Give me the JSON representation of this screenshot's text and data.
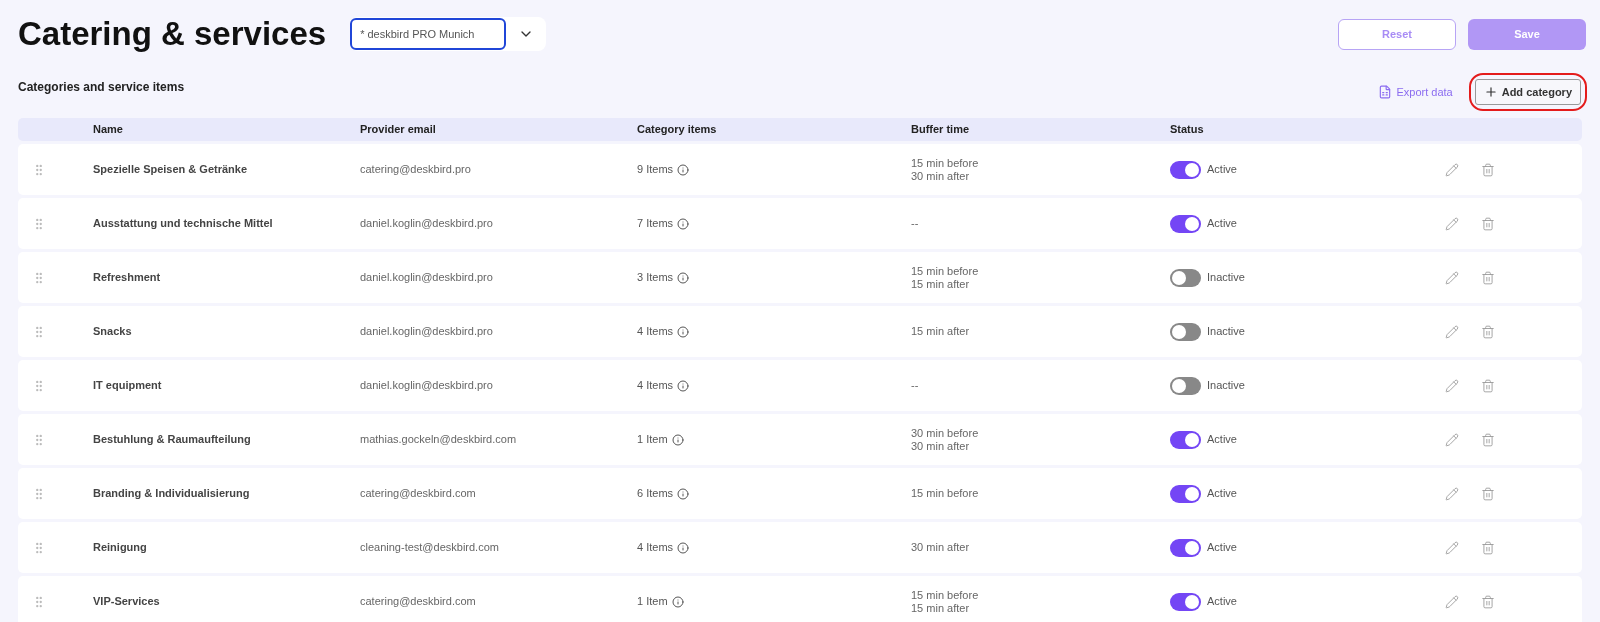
{
  "page_title": "Catering & services",
  "location_select": {
    "value": "* deskbird PRO Munich"
  },
  "buttons": {
    "reset": "Reset",
    "save": "Save"
  },
  "section_title": "Categories and service items",
  "export": "Export data",
  "add_category": {
    "label": "Add category",
    "highlighted": true
  },
  "columns": [
    "Name",
    "Provider email",
    "Category items",
    "Buffer time",
    "Status"
  ],
  "rows": [
    {
      "name": "Spezielle Speisen & Getränke",
      "email": "catering@deskbird.pro",
      "items": "9 Items",
      "buffer": [
        "15 min before",
        "30 min after"
      ],
      "active": true,
      "status": "Active"
    },
    {
      "name": "Ausstattung und technische Mittel",
      "email": "daniel.koglin@deskbird.pro",
      "items": "7 Items",
      "buffer": [
        "--"
      ],
      "active": true,
      "status": "Active"
    },
    {
      "name": "Refreshment",
      "email": "daniel.koglin@deskbird.pro",
      "items": "3 Items",
      "buffer": [
        "15 min before",
        "15 min after"
      ],
      "active": false,
      "status": "Inactive"
    },
    {
      "name": "Snacks",
      "email": "daniel.koglin@deskbird.pro",
      "items": "4 Items",
      "buffer": [
        "15 min after"
      ],
      "active": false,
      "status": "Inactive"
    },
    {
      "name": "IT equipment",
      "email": "daniel.koglin@deskbird.pro",
      "items": "4 Items",
      "buffer": [
        "--"
      ],
      "active": false,
      "status": "Inactive"
    },
    {
      "name": "Bestuhlung & Raumaufteilung",
      "email": "mathias.gockeln@deskbird.com",
      "items": "1 Item",
      "buffer": [
        "30 min before",
        "30 min after"
      ],
      "active": true,
      "status": "Active"
    },
    {
      "name": "Branding & Individualisierung",
      "email": "catering@deskbird.com",
      "items": "6 Items",
      "buffer": [
        "15 min before"
      ],
      "active": true,
      "status": "Active"
    },
    {
      "name": "Reinigung",
      "email": "cleaning-test@deskbird.com",
      "items": "4 Items",
      "buffer": [
        "30 min after"
      ],
      "active": true,
      "status": "Active"
    },
    {
      "name": "VIP-Services",
      "email": "catering@deskbird.com",
      "items": "1 Item",
      "buffer": [
        "15 min before",
        "15 min after"
      ],
      "active": true,
      "status": "Active"
    }
  ]
}
